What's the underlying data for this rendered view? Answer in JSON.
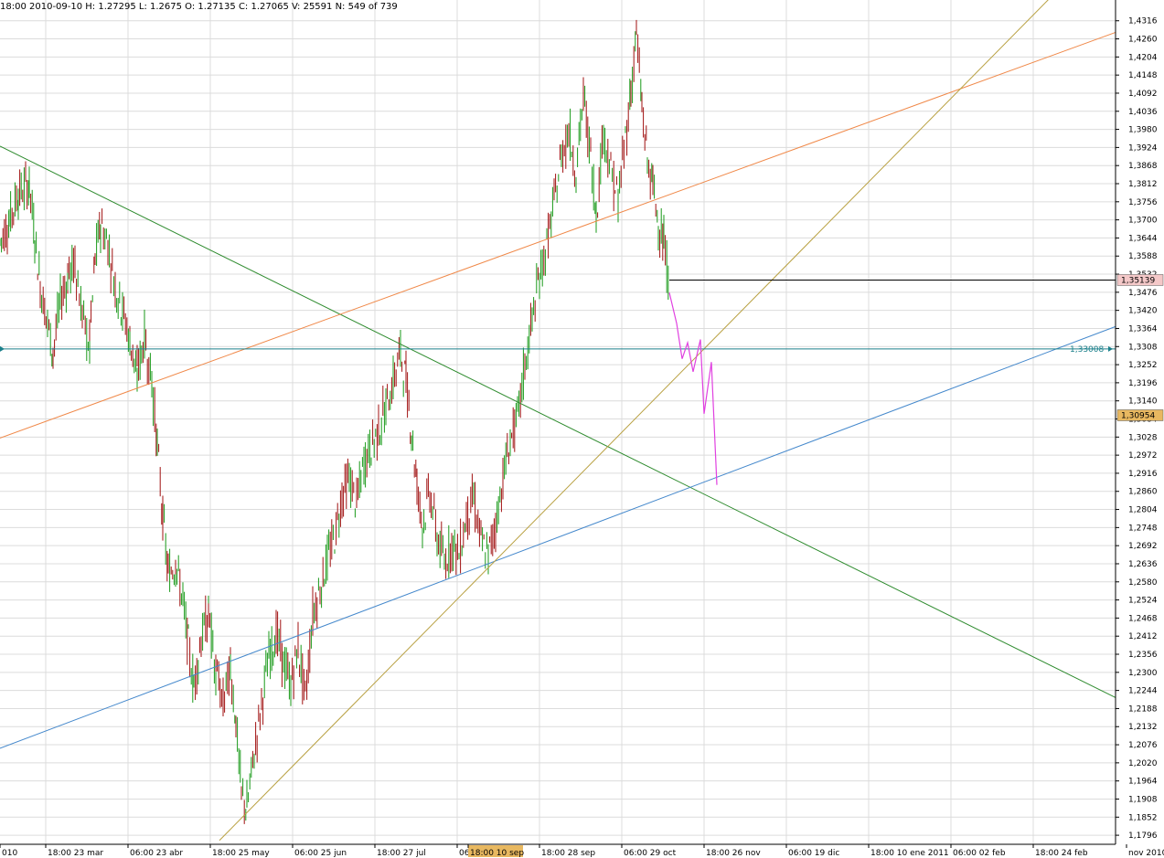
{
  "info_bar": "18:00 2010-09-10  H: 1.27295  L: 1.2675  O: 1.27135  C: 1.27065  V: 25591  N: 549 of 739",
  "chart_data": {
    "type": "candlestick",
    "ylim": [
      1.1768,
      1.4352
    ],
    "y_ticks": [
      "1,4316",
      "1,4260",
      "1,4204",
      "1,4148",
      "1,4092",
      "1,4036",
      "1,3980",
      "1,3924",
      "1,3868",
      "1,3812",
      "1,3756",
      "1,3700",
      "1,3644",
      "1,3588",
      "1,3532",
      "1,3476",
      "1,3420",
      "1,3364",
      "1,3308",
      "1,3252",
      "1,3196",
      "1,3140",
      "1,3084",
      "1,3028",
      "1,2972",
      "1,2916",
      "1,2860",
      "1,2804",
      "1,2748",
      "1,2692",
      "1,2636",
      "1,2580",
      "1,2524",
      "1,2468",
      "1,2412",
      "1,2356",
      "1,2300",
      "1,2244",
      "1,2188",
      "1,2132",
      "1,2076",
      "1,2020",
      "1,1964",
      "1,1908",
      "1,1852",
      "1,1796"
    ],
    "x_labels": [
      "010",
      "18:00 23 mar",
      "06:00 23 abr",
      "18:00 25 may",
      "06:00 25 jun",
      "18:00 27 jul",
      "06",
      "18:00 10 sep",
      "18:00 28 sep",
      "06:00 29 oct",
      "18:00 26 nov",
      "06:00 19 dic",
      "18:00 10 ene 2011",
      "06:00 02 feb",
      "18:00 24 feb",
      "nov 2010"
    ],
    "highlighted_x_label": "18:00 10 sep",
    "price_markers": [
      {
        "label": "1,35139",
        "value": 1.35139,
        "color": "#f4c8c8"
      },
      {
        "label": "1,30954",
        "value": 1.30954,
        "color": "#e8b860"
      }
    ],
    "horizontal_line": {
      "label": "1,33008",
      "value": 1.33008,
      "color": "#1a7f8a"
    },
    "current_price_line": {
      "value": 1.35139,
      "color": "#000000"
    },
    "trendlines": [
      {
        "color": "#2e8b2e",
        "from": [
          0,
          1.3928
        ],
        "to": [
          1220,
          1.2222
        ]
      },
      {
        "color": "#f08848",
        "from": [
          0,
          1.3025
        ],
        "to": [
          1220,
          1.428
        ]
      },
      {
        "color": "#4488cc",
        "from": [
          0,
          1.2065
        ],
        "to": [
          1220,
          1.337
        ]
      },
      {
        "color": "#b8a040",
        "from": [
          240,
          1.178
        ],
        "to": [
          1160,
          1.442
        ]
      }
    ],
    "projection": {
      "color": "#e040e0",
      "points": [
        [
          732,
          1.3475
        ],
        [
          740,
          1.338
        ],
        [
          746,
          1.327
        ],
        [
          752,
          1.332
        ],
        [
          758,
          1.323
        ],
        [
          766,
          1.333
        ],
        [
          770,
          1.31
        ],
        [
          778,
          1.326
        ],
        [
          784,
          1.288
        ]
      ]
    },
    "price_path": [
      [
        0,
        1.363
      ],
      [
        10,
        1.37
      ],
      [
        20,
        1.378
      ],
      [
        32,
        1.381
      ],
      [
        38,
        1.365
      ],
      [
        44,
        1.35
      ],
      [
        52,
        1.338
      ],
      [
        58,
        1.329
      ],
      [
        66,
        1.345
      ],
      [
        74,
        1.352
      ],
      [
        82,
        1.357
      ],
      [
        90,
        1.34
      ],
      [
        98,
        1.331
      ],
      [
        104,
        1.358
      ],
      [
        110,
        1.369
      ],
      [
        118,
        1.362
      ],
      [
        126,
        1.35
      ],
      [
        134,
        1.342
      ],
      [
        142,
        1.333
      ],
      [
        150,
        1.322
      ],
      [
        158,
        1.334
      ],
      [
        166,
        1.32
      ],
      [
        172,
        1.3
      ],
      [
        178,
        1.278
      ],
      [
        184,
        1.26
      ],
      [
        192,
        1.264
      ],
      [
        200,
        1.252
      ],
      [
        206,
        1.238
      ],
      [
        212,
        1.226
      ],
      [
        220,
        1.24
      ],
      [
        228,
        1.248
      ],
      [
        236,
        1.23
      ],
      [
        244,
        1.22
      ],
      [
        252,
        1.232
      ],
      [
        258,
        1.215
      ],
      [
        264,
        1.192
      ],
      [
        270,
        1.188
      ],
      [
        278,
        1.205
      ],
      [
        286,
        1.22
      ],
      [
        294,
        1.235
      ],
      [
        302,
        1.242
      ],
      [
        310,
        1.233
      ],
      [
        318,
        1.226
      ],
      [
        326,
        1.238
      ],
      [
        334,
        1.222
      ],
      [
        342,
        1.248
      ],
      [
        350,
        1.256
      ],
      [
        358,
        1.265
      ],
      [
        366,
        1.272
      ],
      [
        374,
        1.285
      ],
      [
        382,
        1.29
      ],
      [
        390,
        1.282
      ],
      [
        398,
        1.295
      ],
      [
        406,
        1.3
      ],
      [
        414,
        1.305
      ],
      [
        422,
        1.312
      ],
      [
        430,
        1.32
      ],
      [
        438,
        1.329
      ],
      [
        444,
        1.32
      ],
      [
        450,
        1.305
      ],
      [
        456,
        1.288
      ],
      [
        462,
        1.276
      ],
      [
        470,
        1.286
      ],
      [
        478,
        1.272
      ],
      [
        486,
        1.264
      ],
      [
        494,
        1.27
      ],
      [
        502,
        1.266
      ],
      [
        510,
        1.278
      ],
      [
        518,
        1.284
      ],
      [
        526,
        1.27
      ],
      [
        534,
        1.266
      ],
      [
        542,
        1.276
      ],
      [
        550,
        1.29
      ],
      [
        558,
        1.302
      ],
      [
        566,
        1.308
      ],
      [
        574,
        1.325
      ],
      [
        582,
        1.339
      ],
      [
        590,
        1.353
      ],
      [
        598,
        1.362
      ],
      [
        606,
        1.375
      ],
      [
        614,
        1.39
      ],
      [
        622,
        1.398
      ],
      [
        630,
        1.385
      ],
      [
        638,
        1.408
      ],
      [
        646,
        1.39
      ],
      [
        652,
        1.372
      ],
      [
        660,
        1.398
      ],
      [
        668,
        1.385
      ],
      [
        676,
        1.376
      ],
      [
        684,
        1.395
      ],
      [
        690,
        1.41
      ],
      [
        696,
        1.428
      ],
      [
        702,
        1.405
      ],
      [
        708,
        1.388
      ],
      [
        714,
        1.38
      ],
      [
        720,
        1.37
      ],
      [
        726,
        1.362
      ],
      [
        732,
        1.349
      ]
    ]
  }
}
